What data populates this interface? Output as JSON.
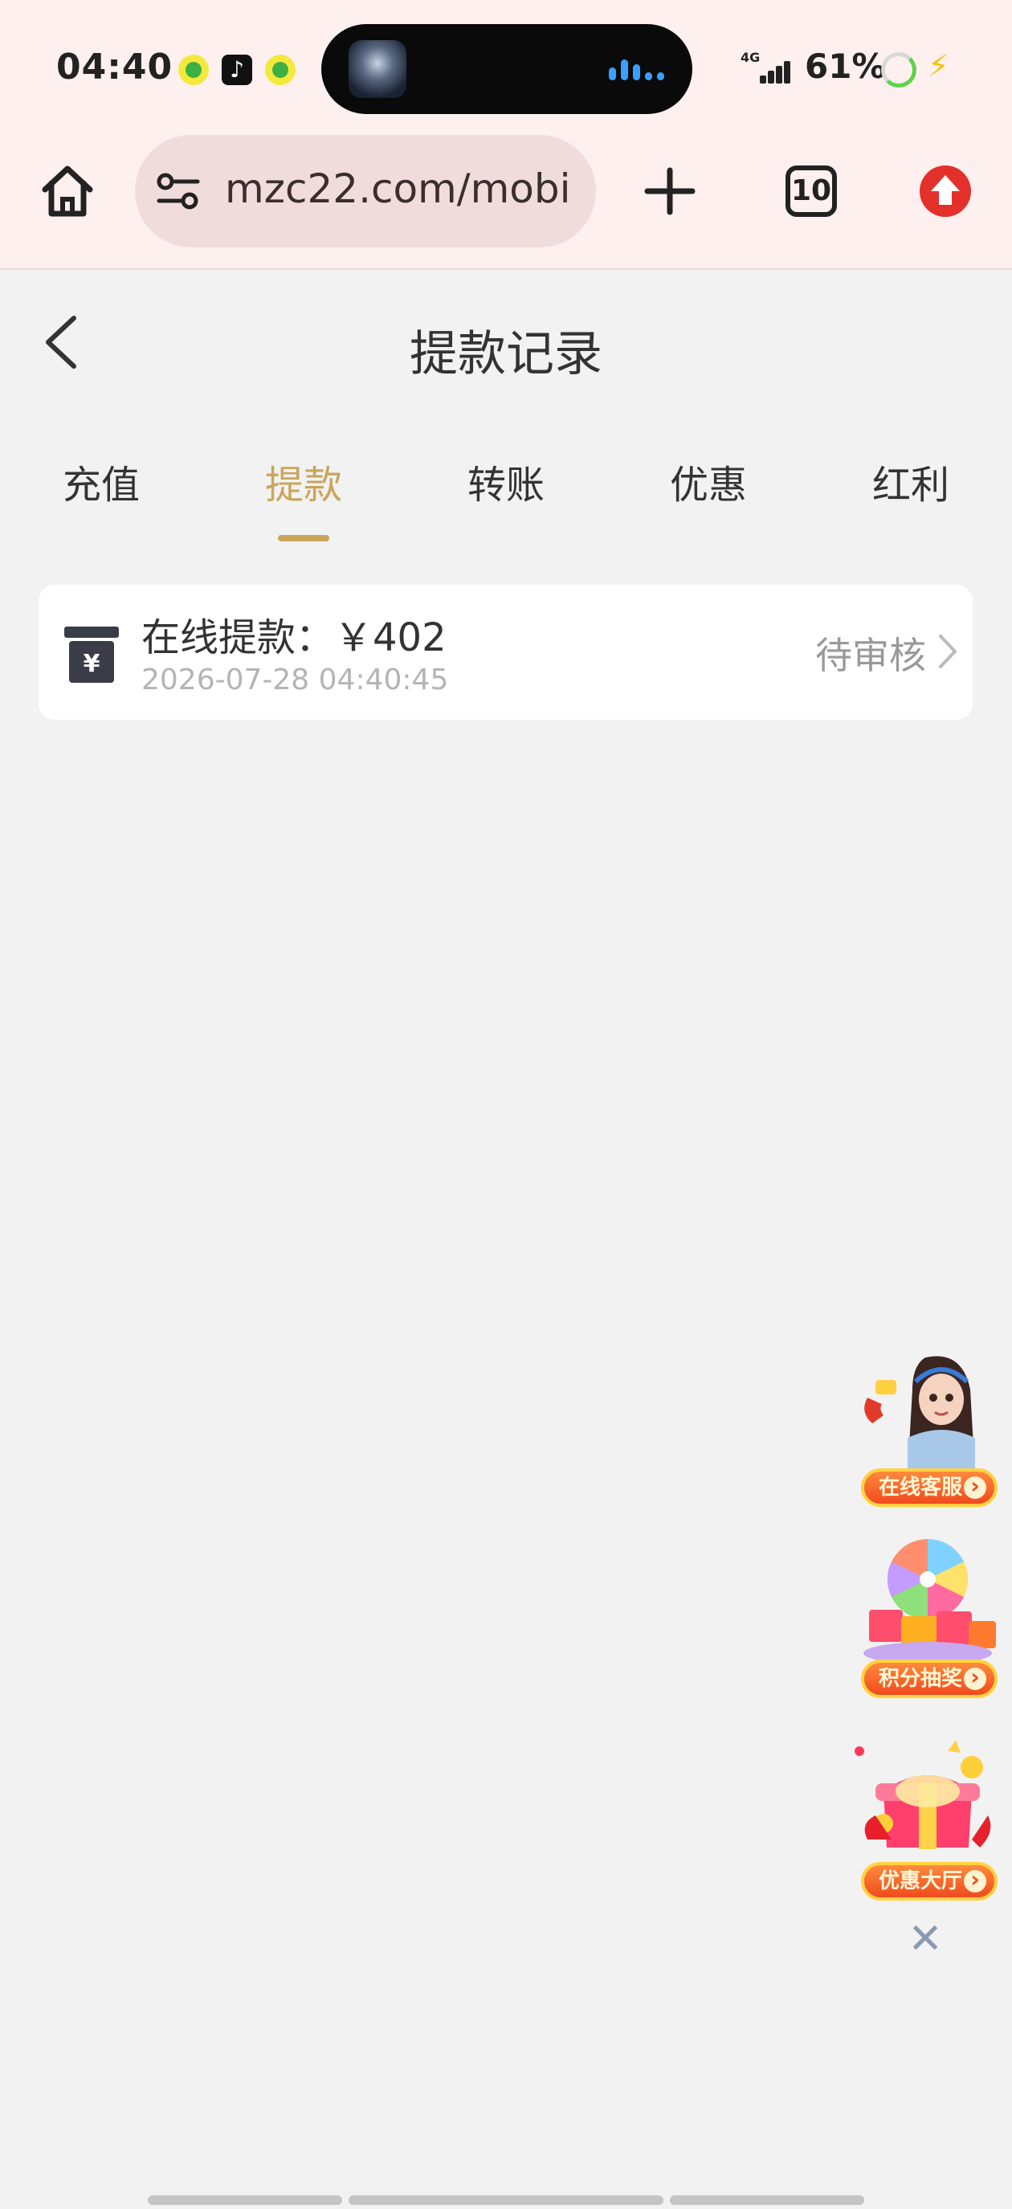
{
  "status_bar": {
    "time": "04:40",
    "network": "4G",
    "battery": "61%"
  },
  "browser": {
    "url": "mzc22.com/mobi",
    "tab_count": "10"
  },
  "page": {
    "title": "提款记录"
  },
  "tabs": [
    {
      "label": "充值",
      "active": false
    },
    {
      "label": "提款",
      "active": true
    },
    {
      "label": "转账",
      "active": false
    },
    {
      "label": "优惠",
      "active": false
    },
    {
      "label": "红利",
      "active": false
    }
  ],
  "records": [
    {
      "title": "在线提款：￥402",
      "time": "2026-07-28 04:40:45",
      "status": "待审核",
      "icon": "atm-yen-icon"
    }
  ],
  "floating": {
    "customer_service": "在线客服",
    "lucky_draw": "积分抽奖",
    "promotions": "优惠大厅"
  },
  "colors": {
    "accent": "#c9a55b",
    "background": "#f2f2f2",
    "browser_bar": "#fdf0ef"
  }
}
